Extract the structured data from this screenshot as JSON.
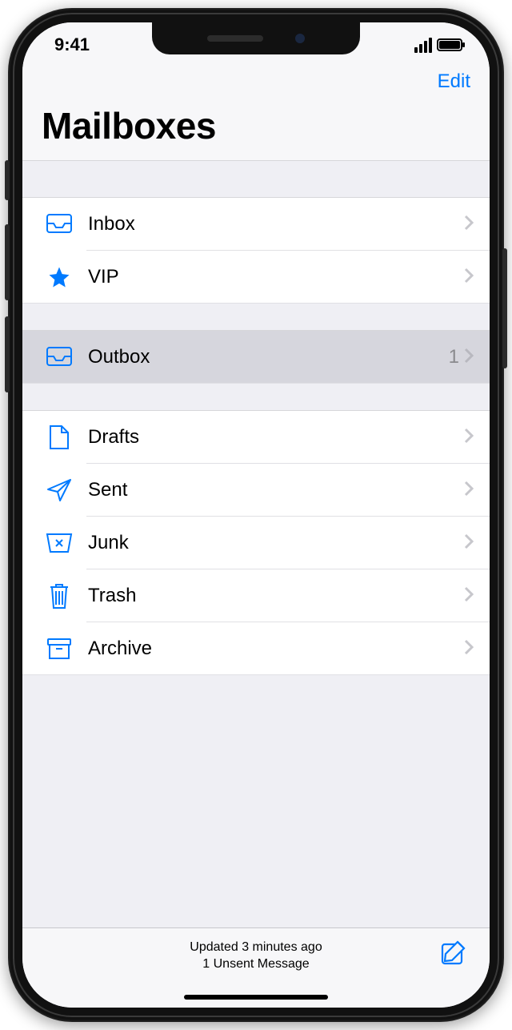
{
  "status": {
    "time": "9:41"
  },
  "navbar": {
    "edit": "Edit"
  },
  "title": "Mailboxes",
  "group1": [
    {
      "id": "inbox",
      "label": "Inbox"
    },
    {
      "id": "vip",
      "label": "VIP"
    }
  ],
  "group2": [
    {
      "id": "outbox",
      "label": "Outbox",
      "count": "1",
      "selected": true
    }
  ],
  "group3": [
    {
      "id": "drafts",
      "label": "Drafts"
    },
    {
      "id": "sent",
      "label": "Sent"
    },
    {
      "id": "junk",
      "label": "Junk"
    },
    {
      "id": "trash",
      "label": "Trash"
    },
    {
      "id": "archive",
      "label": "Archive"
    }
  ],
  "toolbar": {
    "line1": "Updated 3 minutes ago",
    "line2": "1 Unsent Message"
  }
}
